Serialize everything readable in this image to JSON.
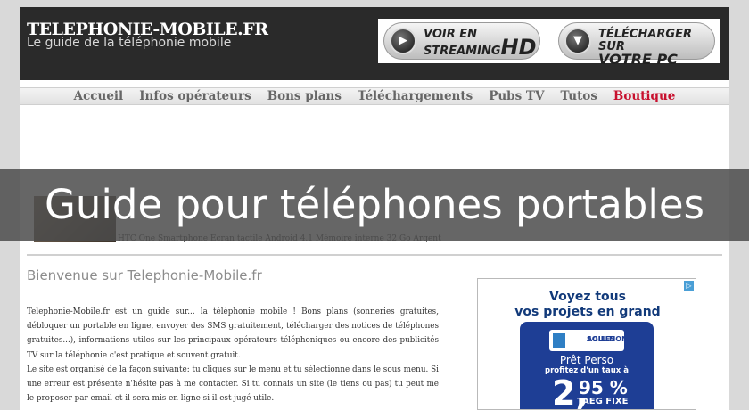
{
  "header": {
    "site_title": "TELEPHONIE-MOBILE.FR",
    "site_subtitle": "Le guide de la téléphonie mobile",
    "banner": {
      "streaming_line1": "VOIR EN",
      "streaming_line2": "STREAMING",
      "streaming_hd": "HD",
      "download_line1": "TÉLÉCHARGER SUR",
      "download_line2": "VOTRE PC"
    }
  },
  "nav": {
    "items": [
      "Accueil",
      "Infos opérateurs",
      "Bons plans",
      "Téléchargements",
      "Pubs TV",
      "Tutos",
      "Boutique"
    ]
  },
  "product": {
    "link_text": "HTC One Smartphone Ecran tactile Android 4.1 Mémoire interne 32 Go Argent"
  },
  "overlay": {
    "title": "Guide pour téléphones portables"
  },
  "main": {
    "welcome": "Bienvenue sur Telephonie-Mobile.fr",
    "intro_p1": "Telephonie-Mobile.fr est un guide sur... la téléphonie mobile ! Bons plans (sonneries gratuites, débloquer un portable en ligne, envoyer des SMS gratuitement, télécharger des notices de téléphones gratuites...), informations utiles sur les principaux opérateurs téléphoniques ou encore des publicités TV sur la téléphonie c'est pratique et souvent gratuit.",
    "intro_p2": "Le site est organisé de la façon suivante: tu cliques sur le menu et tu sélectionne dans le sous menu. Si une erreur est présente n'hésite pas à me contacter. Si tu connais un site (le tiens ou pas) tu peut me le proposer par email et il sera mis en ligne si il est jugé utile."
  },
  "ad": {
    "headline_line1": "Voyez tous",
    "headline_line2": "vos projets en grand",
    "logo_line1": "SOLUTIONS",
    "logo_line2": "AGILES",
    "pret": "Prêt Perso",
    "taux_label": "profitez d'un taux à",
    "rate_int": "2,",
    "rate_dec": "95 %",
    "taeg": "TAEG FIXE",
    "badge": "▷"
  }
}
